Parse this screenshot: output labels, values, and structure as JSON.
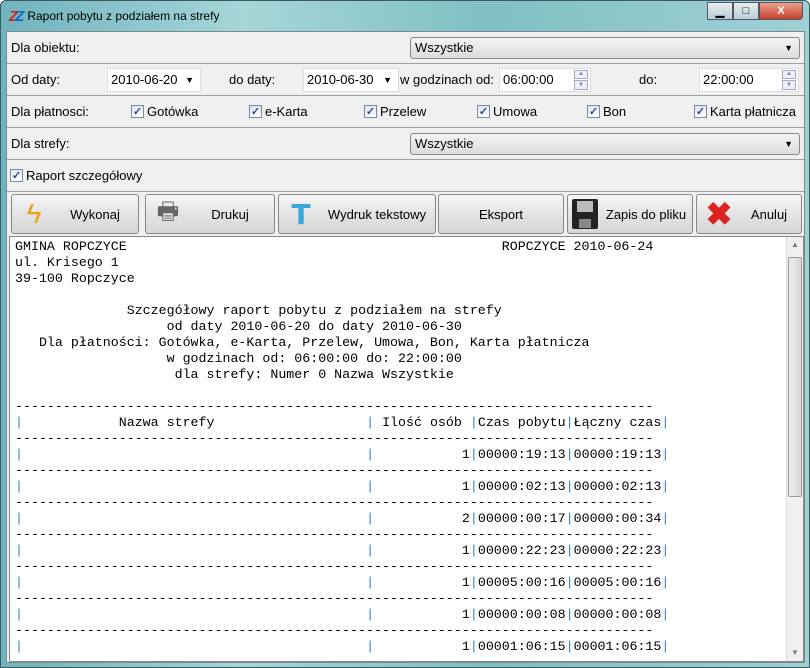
{
  "window": {
    "title": "Raport pobytu z podziałem na strefy",
    "logo": "ZZ",
    "minimize": "▁",
    "maximize": "□",
    "close": "X"
  },
  "filters": {
    "object_label": "Dla obiektu:",
    "object_value": "Wszystkie",
    "from_date_label": "Od daty:",
    "from_date": "2010-06-20",
    "to_date_label": "do daty:",
    "to_date": "2010-06-30",
    "hours_from_label": "w godzinach od:",
    "hours_from": "06:00:00",
    "hours_to_label": "do:",
    "hours_to": "22:00:00",
    "payment_label": "Dla płatnosci:",
    "payments": [
      {
        "label": "Gotówka",
        "checked": true
      },
      {
        "label": "e-Karta",
        "checked": true
      },
      {
        "label": "Przelew",
        "checked": true
      },
      {
        "label": "Umowa",
        "checked": true
      },
      {
        "label": "Bon",
        "checked": true
      },
      {
        "label": "Karta płatnicza",
        "checked": true
      }
    ],
    "zone_label": "Dla strefy:",
    "zone_value": "Wszystkie",
    "detailed_label": "Raport szczegółowy",
    "detailed_checked": true
  },
  "toolbar": {
    "execute": "Wykonaj",
    "print": "Drukuj",
    "text_print": "Wydruk tekstowy",
    "export": "Eksport",
    "save": "Zapis do pliku",
    "cancel": "Anuluj"
  },
  "report": {
    "header_left": [
      "GMINA ROPCZYCE",
      "ul. Krisego 1",
      "39-100 Ropczyce"
    ],
    "header_right": "ROPCZYCE 2010-06-24",
    "title_lines": [
      "Szczegółowy raport pobytu z podziałem na strefy",
      "od daty 2010-06-20 do daty 2010-06-30",
      "Dla płatności: Gotówka, e-Karta, Przelew, Umowa, Bon, Karta płatnicza",
      "w godzinach od: 06:00:00 do: 22:00:00",
      "dla strefy: Numer 0 Nazwa Wszystkie"
    ],
    "columns": [
      "Nazwa strefy",
      "Ilość osób",
      "Czas pobytu",
      "Łączny czas"
    ],
    "rows": [
      {
        "name": "",
        "count": "1",
        "stay": "00000:19:13",
        "total": "00000:19:13"
      },
      {
        "name": "",
        "count": "1",
        "stay": "00000:02:13",
        "total": "00000:02:13"
      },
      {
        "name": "",
        "count": "2",
        "stay": "00000:00:17",
        "total": "00000:00:34"
      },
      {
        "name": "",
        "count": "1",
        "stay": "00000:22:23",
        "total": "00000:22:23"
      },
      {
        "name": "",
        "count": "1",
        "stay": "00005:00:16",
        "total": "00005:00:16"
      },
      {
        "name": "",
        "count": "1",
        "stay": "00000:00:08",
        "total": "00000:00:08"
      },
      {
        "name": "",
        "count": "1",
        "stay": "00001:06:15",
        "total": "00001:06:15"
      }
    ]
  }
}
